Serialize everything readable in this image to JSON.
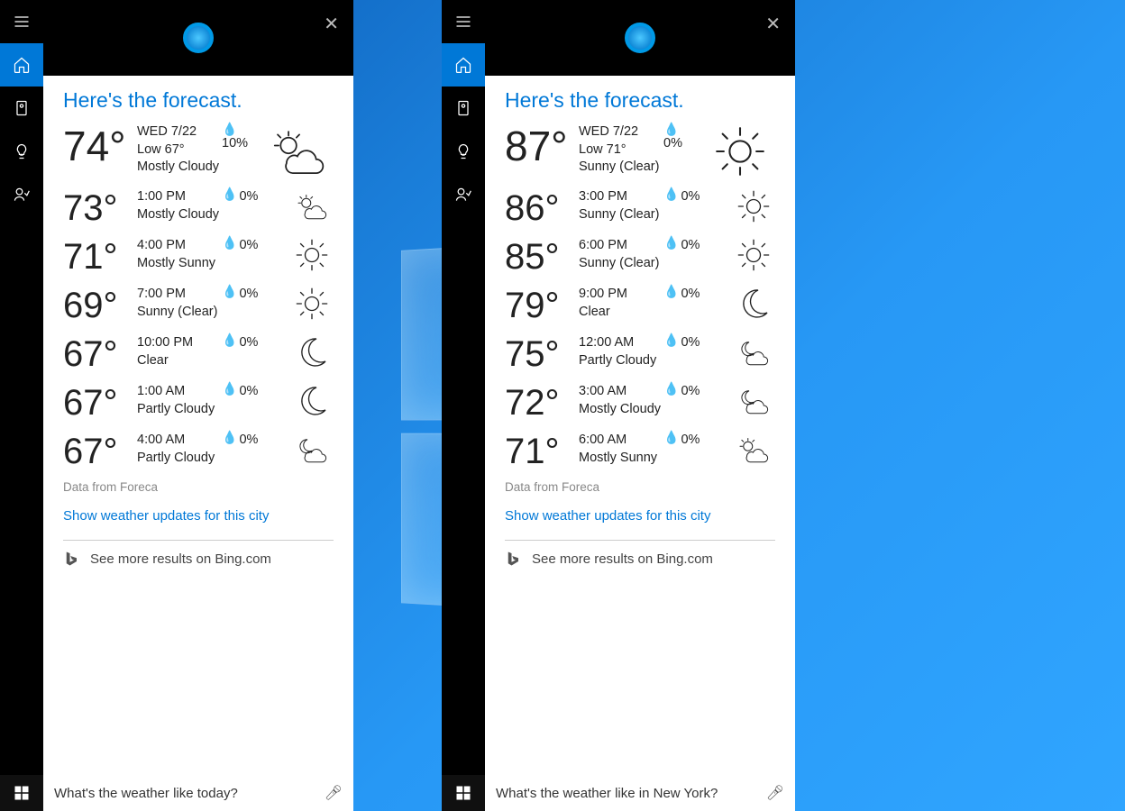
{
  "panels": [
    {
      "searchQuery": "What's the weather like today?",
      "title": "Here's the forecast.",
      "source": "Data from Foreca",
      "updatesLink": "Show weather updates for this city",
      "bingText": "See more results on Bing.com",
      "current": {
        "temp": "74°",
        "date": "WED 7/22",
        "low": "Low 67°",
        "cond": "Mostly Cloudy",
        "precip": "10%",
        "icon": "partly-cloudy"
      },
      "hours": [
        {
          "temp": "73°",
          "time": "1:00 PM",
          "cond": "Mostly Cloudy",
          "precip": "0%",
          "icon": "partly-cloudy"
        },
        {
          "temp": "71°",
          "time": "4:00 PM",
          "cond": "Mostly Sunny",
          "precip": "0%",
          "icon": "sunny"
        },
        {
          "temp": "69°",
          "time": "7:00 PM",
          "cond": "Sunny (Clear)",
          "precip": "0%",
          "icon": "sunny"
        },
        {
          "temp": "67°",
          "time": "10:00 PM",
          "cond": "Clear",
          "precip": "0%",
          "icon": "moon"
        },
        {
          "temp": "67°",
          "time": "1:00 AM",
          "cond": "Partly Cloudy",
          "precip": "0%",
          "icon": "moon"
        },
        {
          "temp": "67°",
          "time": "4:00 AM",
          "cond": "Partly Cloudy",
          "precip": "0%",
          "icon": "night-cloudy"
        }
      ]
    },
    {
      "searchQuery": "What's the weather like in New York?",
      "title": "Here's the forecast.",
      "source": "Data from Foreca",
      "updatesLink": "Show weather updates for this city",
      "bingText": "See more results on Bing.com",
      "current": {
        "temp": "87°",
        "date": "WED 7/22",
        "low": "Low 71°",
        "cond": "Sunny (Clear)",
        "precip": "0%",
        "icon": "sunny"
      },
      "hours": [
        {
          "temp": "86°",
          "time": "3:00 PM",
          "cond": "Sunny (Clear)",
          "precip": "0%",
          "icon": "sunny"
        },
        {
          "temp": "85°",
          "time": "6:00 PM",
          "cond": "Sunny (Clear)",
          "precip": "0%",
          "icon": "sunny"
        },
        {
          "temp": "79°",
          "time": "9:00 PM",
          "cond": "Clear",
          "precip": "0%",
          "icon": "moon"
        },
        {
          "temp": "75°",
          "time": "12:00 AM",
          "cond": "Partly Cloudy",
          "precip": "0%",
          "icon": "night-cloudy"
        },
        {
          "temp": "72°",
          "time": "3:00 AM",
          "cond": "Mostly Cloudy",
          "precip": "0%",
          "icon": "night-cloudy"
        },
        {
          "temp": "71°",
          "time": "6:00 AM",
          "cond": "Mostly Sunny",
          "precip": "0%",
          "icon": "partly-cloudy"
        }
      ]
    }
  ]
}
